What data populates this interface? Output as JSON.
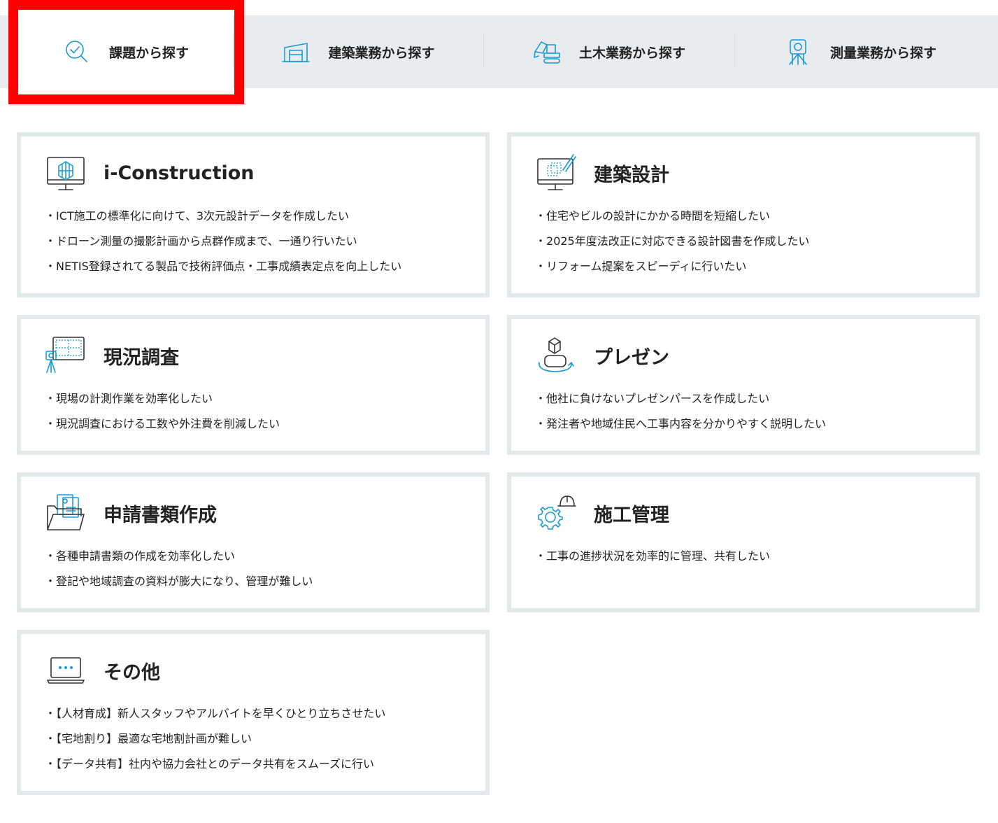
{
  "tabs": [
    {
      "label": "課題から探す",
      "icon": "search-check-icon",
      "active": true
    },
    {
      "label": "建築業務から探す",
      "icon": "building-icon",
      "active": false
    },
    {
      "label": "土木業務から探す",
      "icon": "excavator-icon",
      "active": false
    },
    {
      "label": "測量業務から探す",
      "icon": "surveyor-icon",
      "active": false
    }
  ],
  "cards": [
    {
      "title": "i-Construction",
      "icon": "monitor-cube-icon",
      "items": [
        "ICT施工の標準化に向けて、3次元設計データを作成したい",
        "ドローン測量の撮影計画から点群作成まで、一通り行いたい",
        "NETIS登録されてる製品で技術評価点・工事成績表定点を向上したい"
      ]
    },
    {
      "title": "建築設計",
      "icon": "monitor-design-icon",
      "items": [
        "住宅やビルの設計にかかる時間を短縮したい",
        "2025年度法改正に対応できる設計図書を作成したい",
        "リフォーム提案をスピーディに行いたい"
      ]
    },
    {
      "title": "現況調査",
      "icon": "survey-screen-icon",
      "items": [
        "現場の計測作業を効率化したい",
        "現況調査における工数や外注費を削減したい"
      ]
    },
    {
      "title": "プレゼン",
      "icon": "vr-goggles-icon",
      "items": [
        "他社に負けないプレゼンパースを作成したい",
        "発注者や地域住民へ工事内容を分かりやすく説明したい"
      ]
    },
    {
      "title": "申請書類作成",
      "icon": "folder-documents-icon",
      "items": [
        "各種申請書類の作成を効率化したい",
        "登記や地域調査の資料が膨大になり、管理が難しい"
      ]
    },
    {
      "title": "施工管理",
      "icon": "gear-helmet-icon",
      "items": [
        "工事の進捗状況を効率的に管理、共有したい"
      ]
    },
    {
      "title": "その他",
      "icon": "laptop-more-icon",
      "items": [
        "【人材育成】新人スタッフやアルバイトを早くひとり立ちさせたい",
        "【宅地割り】最適な宅地割計画が難しい",
        "【データ共有】社内や協力会社とのデータ共有をスムーズに行い"
      ]
    }
  ]
}
